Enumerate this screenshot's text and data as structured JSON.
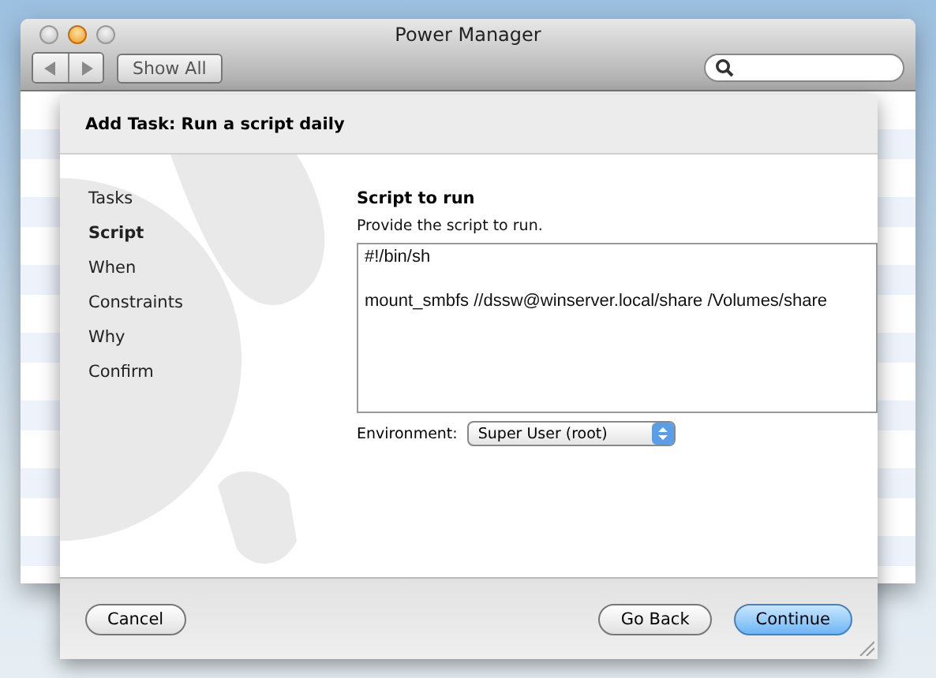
{
  "window": {
    "title": "Power Manager"
  },
  "toolbar": {
    "show_all": "Show All"
  },
  "sheet": {
    "title": "Add Task: Run a script daily",
    "steps": [
      {
        "label": "Tasks",
        "selected": false
      },
      {
        "label": "Script",
        "selected": true
      },
      {
        "label": "When",
        "selected": false
      },
      {
        "label": "Constraints",
        "selected": false
      },
      {
        "label": "Why",
        "selected": false
      },
      {
        "label": "Confirm",
        "selected": false
      }
    ],
    "section_title": "Script to run",
    "instruction": "Provide the script to run.",
    "script": "#!/bin/sh\n\nmount_smbfs //dssw@winserver.local/share /Volumes/share",
    "environment": {
      "label": "Environment:",
      "value": "Super User (root)"
    },
    "left_buttons": [
      {
        "label": "Cancel",
        "kind": "plain"
      }
    ],
    "right_buttons": [
      {
        "label": "Go Back",
        "kind": "plain"
      },
      {
        "label": "Continue",
        "kind": "default"
      }
    ]
  }
}
